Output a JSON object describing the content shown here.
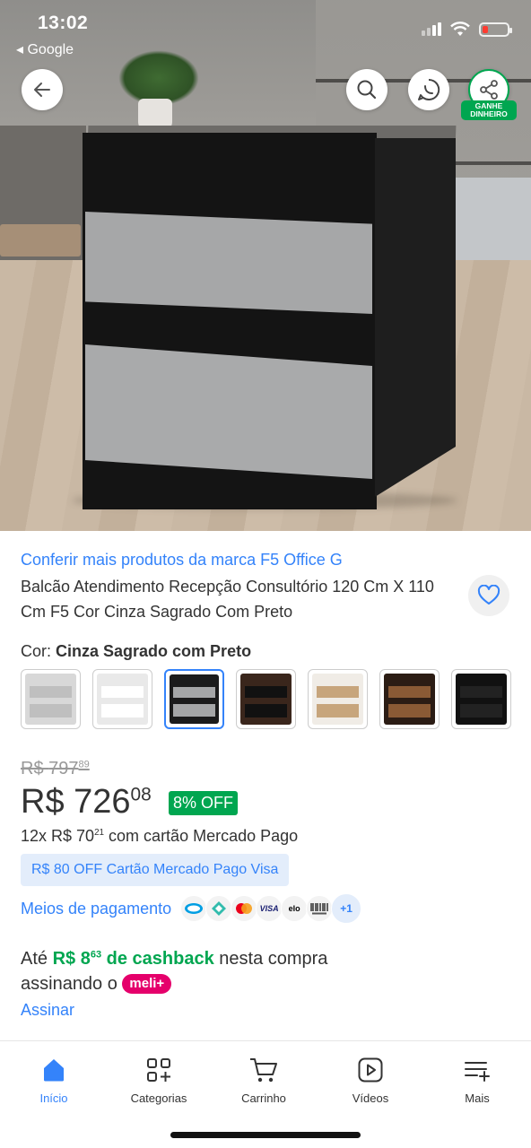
{
  "status_bar": {
    "time": "13:02",
    "back_app": "◂ Google",
    "battery_color": "#ff3b30"
  },
  "hero": {
    "buttons": {
      "back_icon": "arrow-left-icon",
      "search_icon": "search-icon",
      "whatsapp_icon": "whatsapp-share-icon",
      "share_icon": "share-icon",
      "earn_label": "GANHE DINHEIRO"
    }
  },
  "product": {
    "brand_link": "Conferir mais produtos da marca F5 Office G",
    "title": "Balcão Atendimento Recepção Consultório 120 Cm X 110 Cm F5 Cor Cinza Sagrado Com Preto",
    "color_label": "Cor: ",
    "color_value": "Cinza Sagrado com Preto",
    "swatches": [
      {
        "name": "variant-1",
        "bg": "#d8d8d8",
        "band": "#bfbfbf"
      },
      {
        "name": "variant-2",
        "bg": "#e9e9e9",
        "band": "#ffffff"
      },
      {
        "name": "variant-3",
        "bg": "#1b1b1b",
        "band": "#a5a6a7",
        "selected": true
      },
      {
        "name": "variant-4",
        "bg": "#3a261c",
        "band": "#111111"
      },
      {
        "name": "variant-5",
        "bg": "#f0ece6",
        "band": "#c7a57c"
      },
      {
        "name": "variant-6",
        "bg": "#2b1c14",
        "band": "#8a5a35"
      },
      {
        "name": "variant-7",
        "bg": "#111111",
        "band": "#222222"
      }
    ]
  },
  "pricing": {
    "old_currency": "R$ ",
    "old_int": "797",
    "old_cents": "89",
    "currency": "R$ ",
    "price_int": "726",
    "price_cents": "08",
    "discount": "8% OFF",
    "inst_prefix": "12x R$ 70",
    "inst_cents": "21",
    "inst_suffix": " com cartão Mercado Pago",
    "promo": "R$ 80 OFF Cartão Mercado Pago Visa",
    "payment_link": "Meios de pagamento",
    "payment_more": "+1",
    "accent": "#3483fa",
    "green": "#00a650"
  },
  "cashback": {
    "prefix": "Até ",
    "amount_int": "R$ 8",
    "amount_cents": "63",
    "amount_suffix": " de cashback",
    "middle": " nesta compra assinando o ",
    "badge": "meli+",
    "link": "Assinar"
  },
  "tabbar": {
    "items": [
      {
        "label": "Início",
        "icon": "home-icon",
        "active": true
      },
      {
        "label": "Categorias",
        "icon": "categories-icon"
      },
      {
        "label": "Carrinho",
        "icon": "cart-icon"
      },
      {
        "label": "Vídeos",
        "icon": "video-icon"
      },
      {
        "label": "Mais",
        "icon": "menu-plus-icon"
      }
    ]
  }
}
